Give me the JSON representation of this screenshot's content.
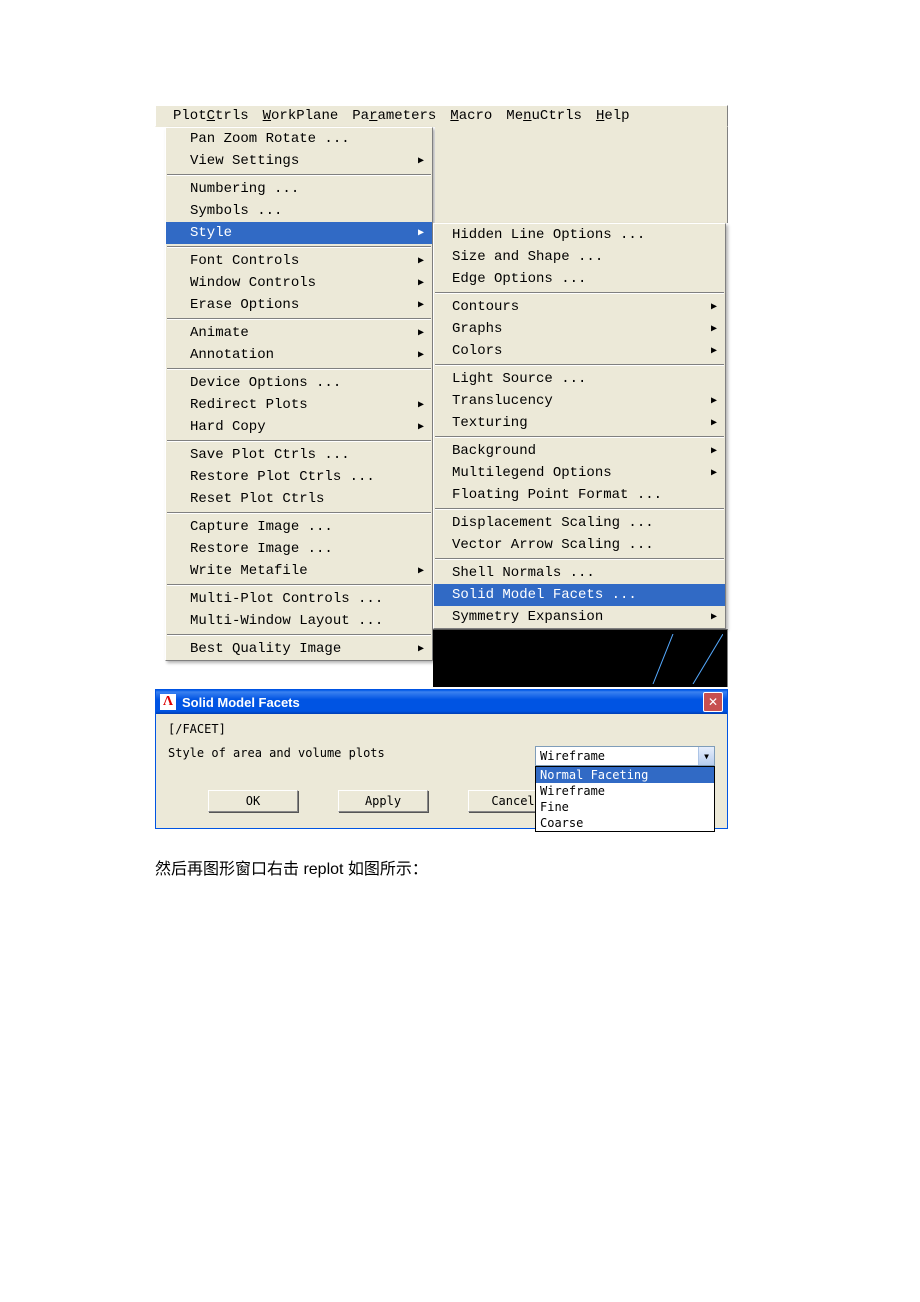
{
  "menubar": [
    "PlotCtrls",
    "WorkPlane",
    "Parameters",
    "Macro",
    "MenuCtrls",
    "Help"
  ],
  "menubar_underline": [
    4,
    0,
    2,
    0,
    2,
    0
  ],
  "plotctrls": [
    {
      "label": "Pan Zoom Rotate  ...",
      "arrow": false
    },
    {
      "label": "View Settings",
      "arrow": true
    },
    {
      "sep": true
    },
    {
      "label": "Numbering  ...",
      "arrow": false
    },
    {
      "label": "Symbols  ...",
      "arrow": false
    },
    {
      "label": "Style",
      "arrow": true,
      "selected": true
    },
    {
      "sep": true
    },
    {
      "label": "Font Controls",
      "arrow": true
    },
    {
      "label": "Window Controls",
      "arrow": true
    },
    {
      "label": "Erase Options",
      "arrow": true
    },
    {
      "sep": true
    },
    {
      "label": "Animate",
      "arrow": true
    },
    {
      "label": "Annotation",
      "arrow": true
    },
    {
      "sep": true
    },
    {
      "label": "Device Options ...",
      "arrow": false
    },
    {
      "label": "Redirect Plots",
      "arrow": true
    },
    {
      "label": "Hard Copy",
      "arrow": true
    },
    {
      "sep": true
    },
    {
      "label": "Save Plot Ctrls  ...",
      "arrow": false
    },
    {
      "label": "Restore Plot Ctrls  ...",
      "arrow": false
    },
    {
      "label": "Reset Plot Ctrls",
      "arrow": false
    },
    {
      "sep": true
    },
    {
      "label": "Capture Image  ...",
      "arrow": false
    },
    {
      "label": "Restore Image  ...",
      "arrow": false
    },
    {
      "label": "Write Metafile",
      "arrow": true
    },
    {
      "sep": true
    },
    {
      "label": "Multi-Plot Controls  ...",
      "arrow": false
    },
    {
      "label": "Multi-Window Layout  ...",
      "arrow": false
    },
    {
      "sep": true
    },
    {
      "label": "Best Quality Image",
      "arrow": true
    }
  ],
  "style_submenu": [
    {
      "label": "Hidden Line Options  ...",
      "arrow": false
    },
    {
      "label": "Size and Shape      ...",
      "arrow": false
    },
    {
      "label": "Edge Options        ...",
      "arrow": false
    },
    {
      "sep": true
    },
    {
      "label": "Contours",
      "arrow": true
    },
    {
      "label": "Graphs",
      "arrow": true
    },
    {
      "label": "Colors",
      "arrow": true
    },
    {
      "sep": true
    },
    {
      "label": "Light Source   ...",
      "arrow": false
    },
    {
      "label": "Translucency",
      "arrow": true
    },
    {
      "label": "Texturing",
      "arrow": true
    },
    {
      "sep": true
    },
    {
      "label": "Background",
      "arrow": true
    },
    {
      "label": "Multilegend Options",
      "arrow": true
    },
    {
      "label": "Floating Point Format  ...",
      "arrow": false
    },
    {
      "sep": true
    },
    {
      "label": "Displacement Scaling  ...",
      "arrow": false
    },
    {
      "label": "Vector Arrow Scaling  ...",
      "arrow": false
    },
    {
      "sep": true
    },
    {
      "label": "Shell Normals  ...",
      "arrow": false
    },
    {
      "label": "Solid Model Facets  ...",
      "arrow": false,
      "selected": true
    },
    {
      "label": "Symmetry Expansion",
      "arrow": true
    }
  ],
  "dialog": {
    "title": "Solid Model Facets",
    "command": "[/FACET]",
    "label": "Style of area and volume plots",
    "selected": "Wireframe",
    "options": [
      "Normal Faceting",
      "Wireframe",
      "Fine",
      "Coarse"
    ],
    "ok": "OK",
    "apply": "Apply",
    "cancel": "Cancel"
  },
  "caption": "然后再图形窗口右击 replot 如图所示："
}
